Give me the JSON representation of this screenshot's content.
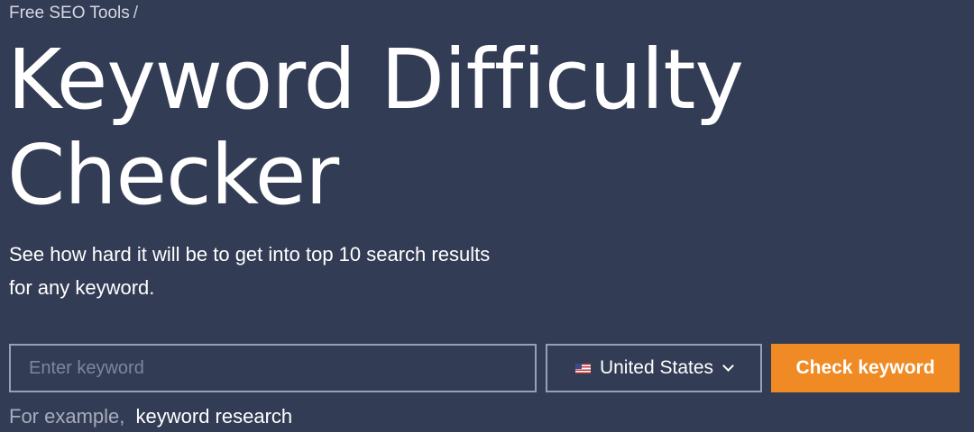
{
  "breadcrumb": {
    "link": "Free SEO Tools",
    "separator": "/"
  },
  "title": {
    "line1": "Keyword Difficulty",
    "line2": "Checker"
  },
  "subtitle": {
    "line1": "See how hard it will be to get into top 10 search results",
    "line2": "for any keyword."
  },
  "search": {
    "value": "",
    "placeholder": "Enter keyword"
  },
  "country": {
    "flag_icon": "us-flag-icon",
    "selected": "United States",
    "dropdown_icon": "chevron-down-icon"
  },
  "check_button": {
    "label": "Check keyword",
    "color": "#f08a24"
  },
  "example": {
    "label": "For example,",
    "link": "keyword research"
  },
  "colors": {
    "background": "#333c55",
    "accent": "#f08a24"
  }
}
